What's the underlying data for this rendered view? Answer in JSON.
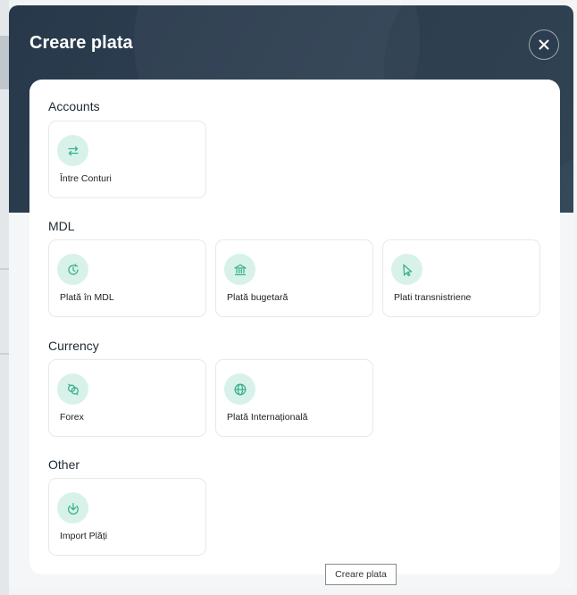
{
  "modal": {
    "title": "Creare plata",
    "close_icon": "close-icon"
  },
  "sections": [
    {
      "title": "Accounts",
      "tiles": [
        {
          "label": "Între Conturi",
          "icon": "transfer-arrows-icon"
        }
      ]
    },
    {
      "title": "MDL",
      "tiles": [
        {
          "label": "Plată în MDL",
          "icon": "clock-refresh-icon"
        },
        {
          "label": "Plată bugetară",
          "icon": "bank-building-icon"
        },
        {
          "label": "Plati transnistriene",
          "icon": "pointer-icon"
        }
      ]
    },
    {
      "title": "Currency",
      "tiles": [
        {
          "label": "Forex",
          "icon": "currency-exchange-icon"
        },
        {
          "label": "Plată Internațională",
          "icon": "globe-icon"
        }
      ]
    },
    {
      "title": "Other",
      "tiles": [
        {
          "label": "Import Plăți",
          "icon": "download-icon"
        }
      ]
    }
  ],
  "tooltip": {
    "text": "Creare plata"
  },
  "colors": {
    "header_bg": "#2f4152",
    "icon_bg": "#d8f2ea",
    "icon_stroke": "#3bb08f"
  }
}
